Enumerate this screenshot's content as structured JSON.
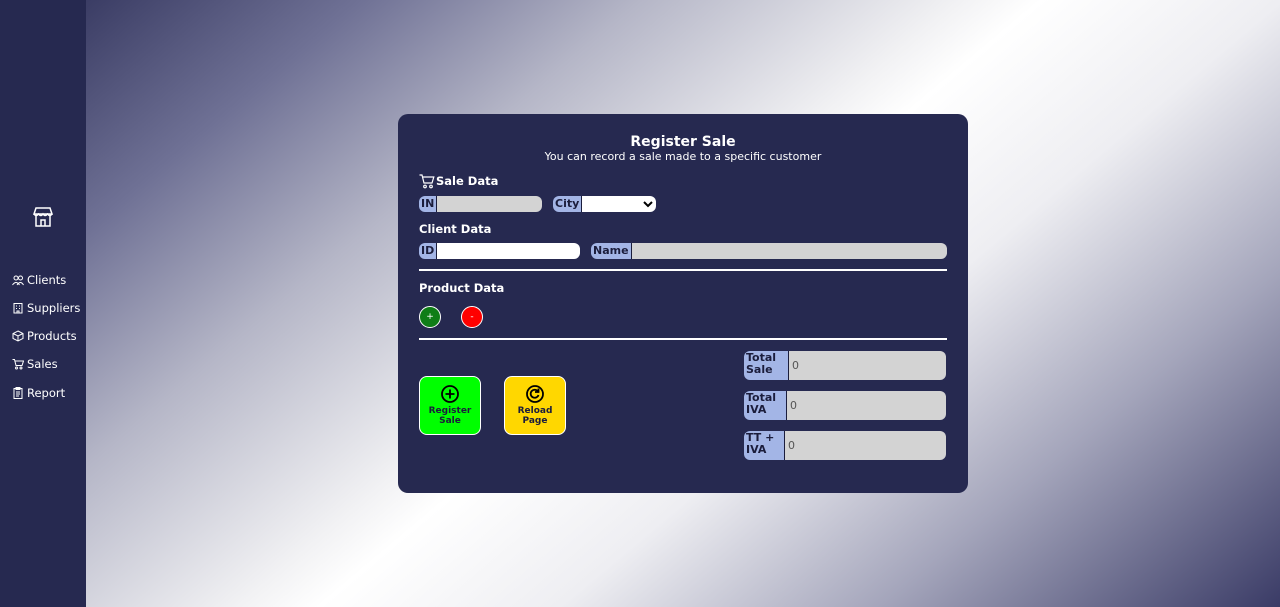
{
  "sidebar": {
    "items": [
      {
        "label": "Clients",
        "icon": "users-icon"
      },
      {
        "label": "Suppliers",
        "icon": "building-icon"
      },
      {
        "label": "Products",
        "icon": "box-icon"
      },
      {
        "label": "Sales",
        "icon": "cart-icon"
      },
      {
        "label": "Report",
        "icon": "clipboard-icon"
      }
    ]
  },
  "form": {
    "title": "Register Sale",
    "subtitle": "You can record a sale made to a specific customer",
    "sale_section": "Sale Data",
    "in_label": "IN",
    "city_label": "City",
    "city_selected": "",
    "client_section": "Client Data",
    "id_label": "ID",
    "name_label": "Name",
    "product_section": "Product Data",
    "add_product": "+",
    "remove_product": "-",
    "register_button": "Register Sale",
    "reload_button": "Reload Page",
    "totals": [
      {
        "label": "Total Sale",
        "value": "0"
      },
      {
        "label": "Total IVA",
        "value": "0"
      },
      {
        "label": "TT + IVA",
        "value": "0"
      }
    ]
  },
  "colors": {
    "sidebar": "#262950",
    "card": "#262950",
    "label_bg": "#a3b5e6",
    "add_button": "#0f7d17",
    "remove_button": "#ff0000",
    "register_button": "#00ff00",
    "reload_button": "#ffd700"
  }
}
